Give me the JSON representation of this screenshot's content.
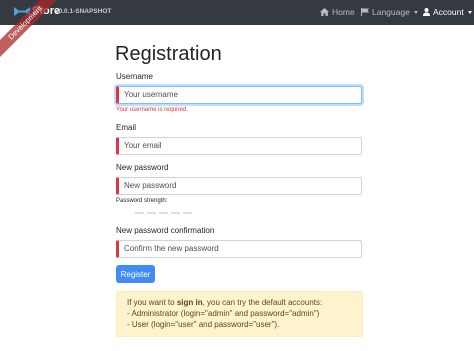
{
  "navbar": {
    "brand_title": "Store",
    "brand_version": "v0.0.1-SNAPSHOT",
    "home_label": "Home",
    "language_label": "Language",
    "account_label": "Account"
  },
  "ribbon": {
    "text": "Development"
  },
  "page": {
    "title": "Registration"
  },
  "form": {
    "username": {
      "label": "Username",
      "placeholder": "Your username",
      "error": "Your username is required."
    },
    "email": {
      "label": "Email",
      "placeholder": "Your email"
    },
    "password": {
      "label": "New password",
      "placeholder": "New password",
      "strength_label": "Password strength:"
    },
    "confirm": {
      "label": "New password confirmation",
      "placeholder": "Confirm the new password"
    },
    "submit_label": "Register"
  },
  "alert": {
    "prefix": "If you want to ",
    "link": "sign in",
    "suffix": ", you can try the default accounts:",
    "line1": "- Administrator (login=\"admin\" and password=\"admin\")",
    "line2": "- User (login=\"user\" and password=\"user\")."
  },
  "colors": {
    "navbar_bg": "#343a40",
    "primary": "#3f8cf7",
    "danger": "#dc3545",
    "alert_bg": "#fff3cd",
    "ribbon": "#aa2828"
  },
  "icons": [
    "logo-icon",
    "home-icon",
    "flag-icon",
    "user-icon"
  ]
}
